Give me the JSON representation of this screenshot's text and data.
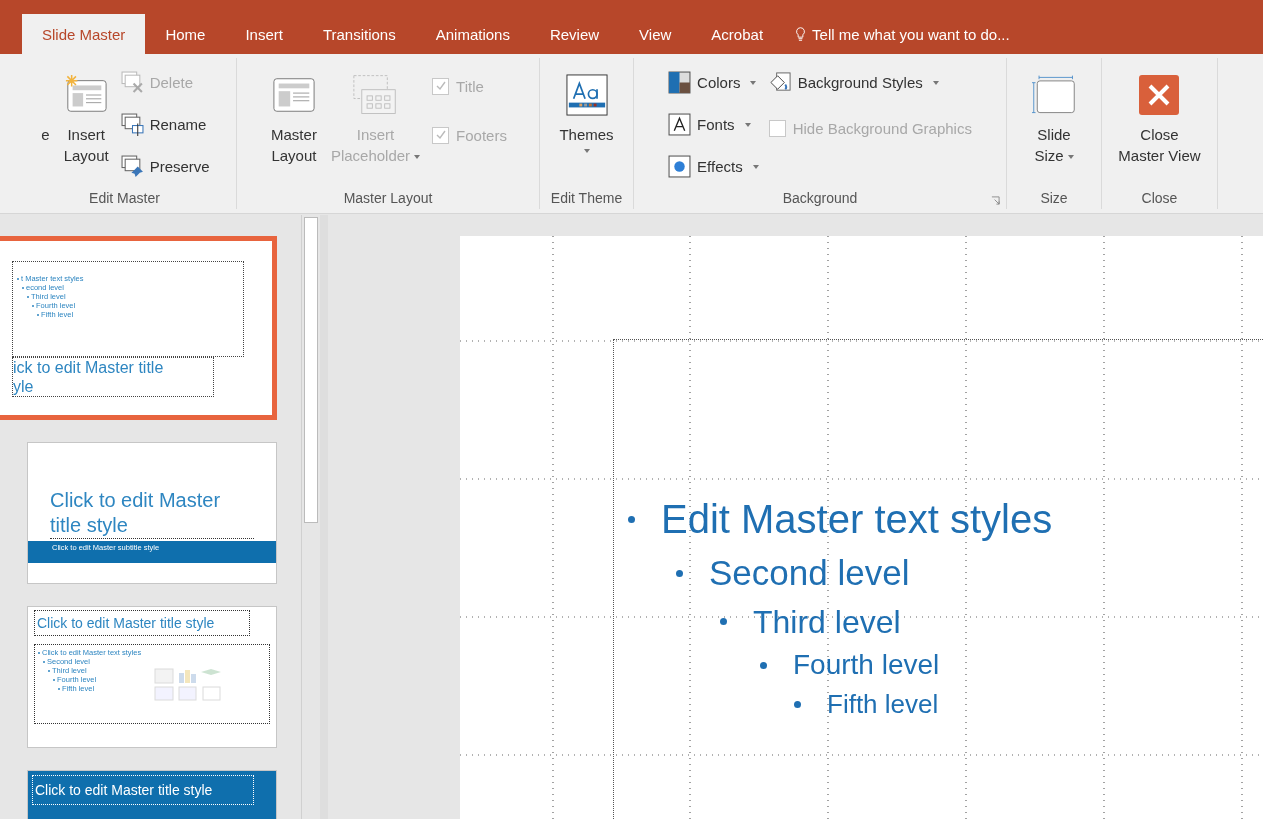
{
  "tabs": [
    {
      "label": "Slide Master",
      "selected": true
    },
    {
      "label": "Home",
      "selected": false
    },
    {
      "label": "Insert",
      "selected": false
    },
    {
      "label": "Transitions",
      "selected": false
    },
    {
      "label": "Animations",
      "selected": false
    },
    {
      "label": "Review",
      "selected": false
    },
    {
      "label": "View",
      "selected": false
    },
    {
      "label": "Acrobat",
      "selected": false
    }
  ],
  "tell_me": {
    "placeholder": "Tell me what you want to do..."
  },
  "ribbon": {
    "groups": [
      {
        "label": "Edit Master",
        "columns": [
          [
            {
              "kind": "large",
              "lines": [
                "e"
              ],
              "disabled": false,
              "dropdown": false
            }
          ],
          [
            {
              "kind": "large",
              "lines": [
                "Insert",
                "Layout"
              ],
              "disabled": false,
              "dropdown": false
            }
          ],
          [
            {
              "kind": "small",
              "label": "Delete",
              "disabled": true,
              "dropdown": false
            },
            {
              "kind": "small",
              "label": "Rename",
              "disabled": false,
              "dropdown": false
            },
            {
              "kind": "small",
              "label": "Preserve",
              "disabled": false,
              "dropdown": false
            }
          ]
        ]
      },
      {
        "label": "Master Layout",
        "columns": [
          [
            {
              "kind": "large",
              "lines": [
                "Master",
                "Layout"
              ],
              "disabled": false,
              "dropdown": false
            }
          ],
          [
            {
              "kind": "large",
              "lines": [
                "Insert",
                "Placeholder"
              ],
              "disabled": true,
              "dropdown": true
            }
          ],
          [
            {
              "kind": "check",
              "label": "Title",
              "checked": true,
              "disabled": true
            },
            {
              "kind": "check",
              "label": "Footers",
              "checked": true,
              "disabled": true
            }
          ]
        ]
      },
      {
        "label": "Edit Theme",
        "columns": [
          [
            {
              "kind": "large",
              "lines": [
                "Themes"
              ],
              "disabled": false,
              "dropdown": true
            }
          ]
        ]
      },
      {
        "label": "Background",
        "columns": [
          [
            {
              "kind": "small",
              "label": "Colors",
              "disabled": false,
              "dropdown": true
            },
            {
              "kind": "small",
              "label": "Fonts",
              "disabled": false,
              "dropdown": true
            },
            {
              "kind": "small",
              "label": "Effects",
              "disabled": false,
              "dropdown": true
            }
          ],
          [
            {
              "kind": "small",
              "label": "Background Styles",
              "disabled": false,
              "dropdown": true
            },
            {
              "kind": "check",
              "label": "Hide Background Graphics",
              "checked": false,
              "disabled": true
            }
          ]
        ]
      },
      {
        "label": "Size",
        "columns": [
          [
            {
              "kind": "large",
              "lines": [
                "Slide",
                "Size"
              ],
              "disabled": false,
              "dropdown": true
            }
          ]
        ]
      },
      {
        "label": "Close",
        "columns": [
          [
            {
              "kind": "large",
              "lines": [
                "Close",
                "Master View"
              ],
              "disabled": false,
              "dropdown": false
            }
          ]
        ]
      }
    ]
  },
  "thumbnails": [
    {
      "kind": "master",
      "selected": true,
      "title_lines": [
        "ick to edit Master title",
        "yle"
      ],
      "bullets": [
        {
          "text": "t Master text styles",
          "children": [
            {
              "text": "econd level",
              "children": [
                {
                  "text": "Third level",
                  "children": [
                    {
                      "text": "Fourth level",
                      "children": [
                        {
                          "text": "Fifth level"
                        }
                      ]
                    }
                  ]
                }
              ]
            }
          ]
        }
      ]
    },
    {
      "kind": "title",
      "selected": false,
      "title_lines": [
        "Click to edit Master",
        "title style"
      ],
      "subtitle": "Click to edit Master subtitle style"
    },
    {
      "kind": "content",
      "selected": false,
      "title_lines": [
        "Click to edit Master title style"
      ],
      "bullets": [
        {
          "text": "Click to edit Master text styles",
          "children": [
            {
              "text": "Second level",
              "children": [
                {
                  "text": "Third level",
                  "children": [
                    {
                      "text": "Fourth level",
                      "children": [
                        {
                          "text": "Fifth level"
                        }
                      ]
                    }
                  ]
                }
              ]
            }
          ]
        }
      ]
    },
    {
      "kind": "section",
      "selected": false,
      "title_lines": [
        "Click to edit Master title style"
      ]
    }
  ],
  "slide": {
    "bullets": [
      {
        "text": "Edit Master text styles",
        "children": [
          {
            "text": "Second level",
            "children": [
              {
                "text": "Third level",
                "children": [
                  {
                    "text": "Fourth level",
                    "children": [
                      {
                        "text": "Fifth level"
                      }
                    ]
                  }
                ]
              }
            ]
          }
        ]
      }
    ]
  }
}
